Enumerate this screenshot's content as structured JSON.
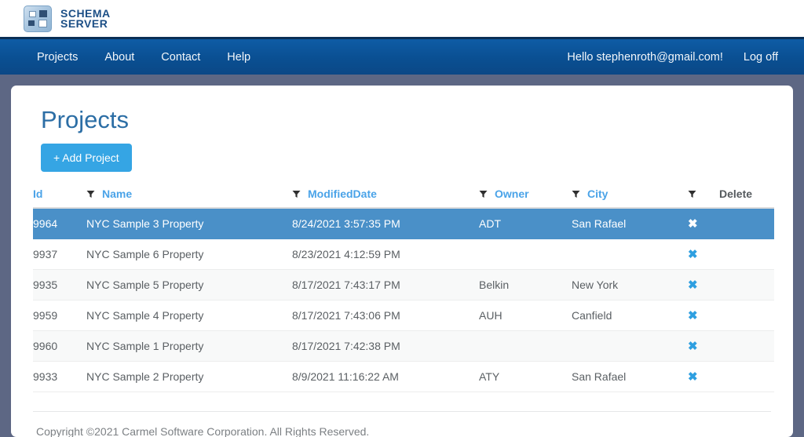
{
  "brand": {
    "line1": "SCHEMA",
    "line2": "SERVER",
    "logo_icon": "schema-server-logo-icon"
  },
  "nav": {
    "items": [
      {
        "label": "Projects"
      },
      {
        "label": "About"
      },
      {
        "label": "Contact"
      },
      {
        "label": "Help"
      }
    ],
    "greeting": "Hello stephenroth@gmail.com!",
    "logoff_label": "Log off"
  },
  "main": {
    "title": "Projects",
    "add_button_label": "+ Add Project"
  },
  "table": {
    "columns": [
      {
        "label": "Id",
        "link": true,
        "filter": true
      },
      {
        "label": "Name",
        "link": true,
        "filter": true
      },
      {
        "label": "ModifiedDate",
        "link": true,
        "filter": true
      },
      {
        "label": "Owner",
        "link": true,
        "filter": true
      },
      {
        "label": "City",
        "link": true,
        "filter": true
      },
      {
        "label": "Delete",
        "link": false,
        "filter": false
      }
    ],
    "delete_icon": "x-delete-icon",
    "filter_icon": "filter-funnel-icon",
    "rows": [
      {
        "id": "9964",
        "name": "NYC Sample 3 Property",
        "modified": "8/24/2021 3:57:35 PM",
        "owner": "ADT",
        "city": "San Rafael",
        "selected": true
      },
      {
        "id": "9937",
        "name": "NYC Sample 6 Property",
        "modified": "8/23/2021 4:12:59 PM",
        "owner": "",
        "city": "",
        "selected": false
      },
      {
        "id": "9935",
        "name": "NYC Sample 5 Property",
        "modified": "8/17/2021 7:43:17 PM",
        "owner": "Belkin",
        "city": "New York",
        "selected": false
      },
      {
        "id": "9959",
        "name": "NYC Sample 4 Property",
        "modified": "8/17/2021 7:43:06 PM",
        "owner": "AUH",
        "city": "Canfield",
        "selected": false
      },
      {
        "id": "9960",
        "name": "NYC Sample 1 Property",
        "modified": "8/17/2021 7:42:38 PM",
        "owner": "",
        "city": "",
        "selected": false
      },
      {
        "id": "9933",
        "name": "NYC Sample 2 Property",
        "modified": "8/9/2021 11:16:22 AM",
        "owner": "ATY",
        "city": "San Rafael",
        "selected": false
      }
    ]
  },
  "footer": {
    "copyright": "Copyright ©2021 Carmel Software Corporation. All Rights Reserved."
  },
  "colors": {
    "nav_blue": "#0a4f92",
    "page_bg": "#5d6784",
    "accent_blue": "#35a5e4",
    "title_blue": "#2c6ea5",
    "selected_row": "#4a90c8",
    "link_blue": "#4aa3e8"
  }
}
